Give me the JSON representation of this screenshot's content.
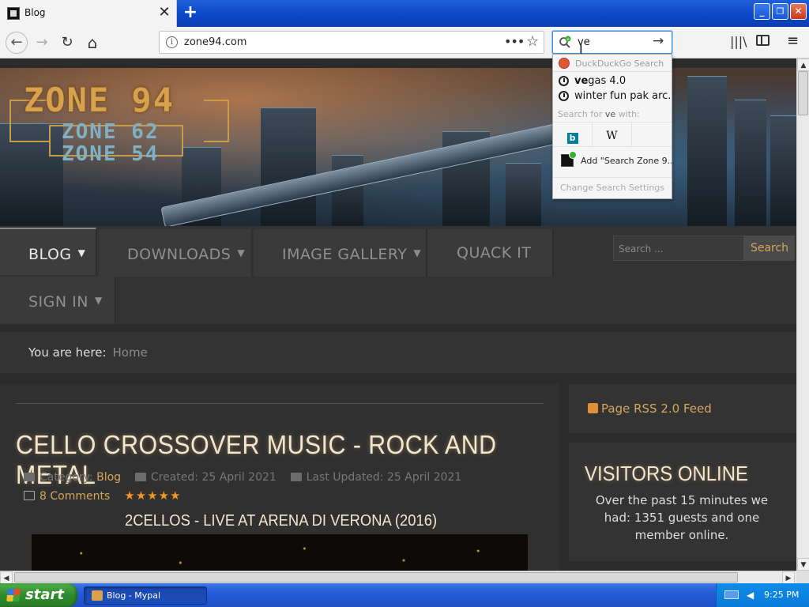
{
  "browser": {
    "tab_title": "Blog",
    "tab_close": "✕",
    "new_tab": "+",
    "url": "zone94.com",
    "url_info": "i",
    "url_more": "•••",
    "url_star": "☆",
    "search_query": "ve",
    "search_go": "→",
    "nav": {
      "back": "←",
      "forward": "→",
      "reload": "↻",
      "home": "⌂"
    },
    "library_icon": "|||\\",
    "menu_icon": "≡",
    "window_controls": {
      "minimize": "_",
      "maximize": "❐",
      "close": "✕"
    }
  },
  "search_popup": {
    "engine": "DuckDuckGo Search",
    "history": [
      {
        "bold": "ve",
        "rest": "gas 4.0"
      },
      {
        "bold": "",
        "rest": "winter fun pak arc..."
      }
    ],
    "search_for_prefix": "Search for ",
    "search_for_term": "ve",
    "search_for_suffix": " with:",
    "engines": [
      {
        "icon": "b",
        "name": "bing-icon"
      },
      {
        "icon": "W",
        "name": "wikipedia-icon"
      }
    ],
    "add_engine": "Add \"Search Zone 9...",
    "change_settings": "Change Search Settings"
  },
  "site": {
    "logo_main": "ZONE 94",
    "logo_sub1": "ZONE 62",
    "logo_sub2": "ZONE 54",
    "menu": [
      "BLOG",
      "DOWNLOADS",
      "IMAGE GALLERY",
      "QUACK IT",
      "SIGN IN"
    ],
    "caret": "▼",
    "search_placeholder": "Search ...",
    "search_button": "Search",
    "breadcrumb_label": "You are here:",
    "breadcrumb_home": "Home"
  },
  "article": {
    "title": "CELLO CROSSOVER MUSIC - ROCK AND METAL",
    "category_label": "Category: ",
    "category": "Blog",
    "created": "Created: 25 April 2021",
    "updated": "Last Updated: 25 April 2021",
    "comments": "8 Comments",
    "stars": "★★★★★",
    "rating": 5,
    "video_title": "2CELLOS - LIVE AT ARENA DI VERONA (2016)"
  },
  "sidebar": {
    "rss": "Page RSS 2.0 Feed",
    "visitors_title": "VISITORS ONLINE",
    "visitors_text": "Over the past 15 minutes we had: 1351 guests and one member online."
  },
  "taskbar": {
    "start": "start",
    "task": "Blog - Mypal",
    "clock": "9:25 PM"
  }
}
